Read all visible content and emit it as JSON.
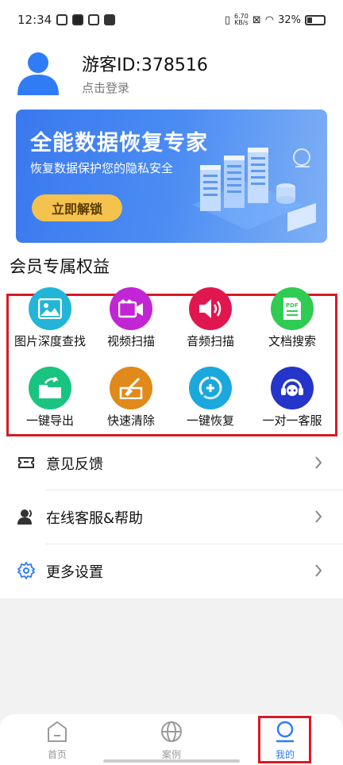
{
  "status_bar": {
    "time": "12:34",
    "net_speed_value": "6.70",
    "net_speed_unit": "KB/s",
    "battery": "32%"
  },
  "profile": {
    "username": "游客ID:378516",
    "login_prompt": "点击登录"
  },
  "banner": {
    "title": "全能数据恢复专家",
    "subtitle": "恢复数据保护您的隐私安全",
    "button_label": "立即解锁"
  },
  "section": {
    "title": "会员专属权益"
  },
  "features": [
    {
      "label": "图片深度查找",
      "icon": "image-icon",
      "color": "#22b5d8"
    },
    {
      "label": "视频扫描",
      "icon": "video-camera-icon",
      "color": "#c226d4"
    },
    {
      "label": "音频扫描",
      "icon": "speaker-icon",
      "color": "#e0174f"
    },
    {
      "label": "文档搜索",
      "icon": "pdf-document-icon",
      "color": "#2fcb52"
    },
    {
      "label": "一键导出",
      "icon": "folder-export-icon",
      "color": "#18c47f"
    },
    {
      "label": "快速清除",
      "icon": "broom-icon",
      "color": "#e08a1c"
    },
    {
      "label": "一键恢复",
      "icon": "restore-icon",
      "color": "#1ba8dc"
    },
    {
      "label": "一对一客服",
      "icon": "headset-icon",
      "color": "#2535c9"
    }
  ],
  "menu": {
    "feedback": "意见反馈",
    "support": "在线客服&帮助",
    "settings": "更多设置"
  },
  "tabs": {
    "home": "首页",
    "cases": "案例",
    "mine": "我的"
  },
  "colors": {
    "accent": "#2f7cf6",
    "highlight_box": "#d81a26"
  }
}
